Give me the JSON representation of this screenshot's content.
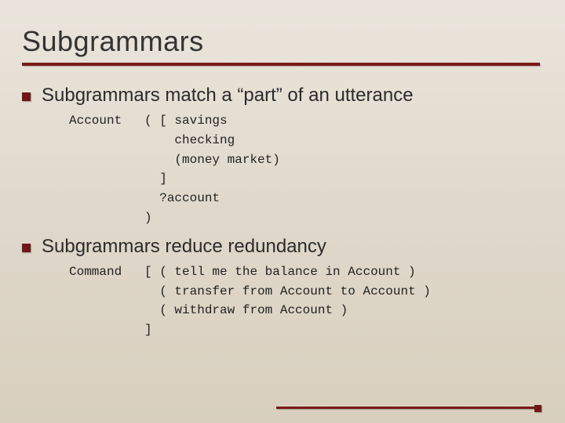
{
  "slide": {
    "title": "Subgrammars",
    "bullets": [
      {
        "text": "Subgrammars match a “part” of an utterance",
        "code": "Account   ( [ savings\n              checking\n              (money market)\n            ]\n            ?account\n          )"
      },
      {
        "text": "Subgrammars reduce redundancy",
        "code": "Command   [ ( tell me the balance in Account )\n            ( transfer from Account to Account )\n            ( withdraw from Account )\n          ]"
      }
    ]
  }
}
